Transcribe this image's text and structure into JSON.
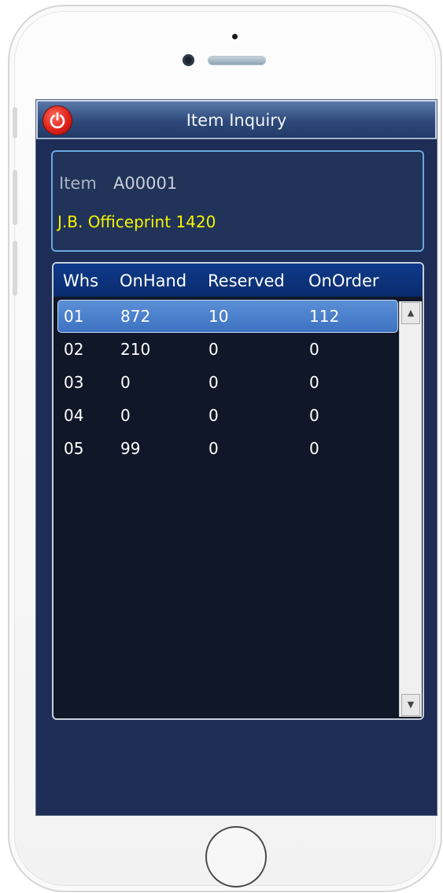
{
  "app": {
    "title": "Item Inquiry"
  },
  "item": {
    "label": "Item",
    "code": "A00001",
    "description": "J.B. Officeprint 1420"
  },
  "table": {
    "columns": [
      "Whs",
      "OnHand",
      "Reserved",
      "OnOrder"
    ],
    "rows": [
      [
        "01",
        "872",
        "10",
        "112"
      ],
      [
        "02",
        "210",
        "0",
        "0"
      ],
      [
        "03",
        "0",
        "0",
        "0"
      ],
      [
        "04",
        "0",
        "0",
        "0"
      ],
      [
        "05",
        "99",
        "0",
        "0"
      ]
    ],
    "selected_row": 0
  },
  "icons": {
    "power": "power-icon",
    "scroll_up": "scroll-up-arrow-icon",
    "scroll_down": "scroll-down-arrow-icon"
  },
  "colors": {
    "background": "#1e2d55",
    "title_bar": "#2e4a7a",
    "description_text": "#f5f500",
    "selected_row": "#4a80cc",
    "power_button": "#e0231a"
  }
}
